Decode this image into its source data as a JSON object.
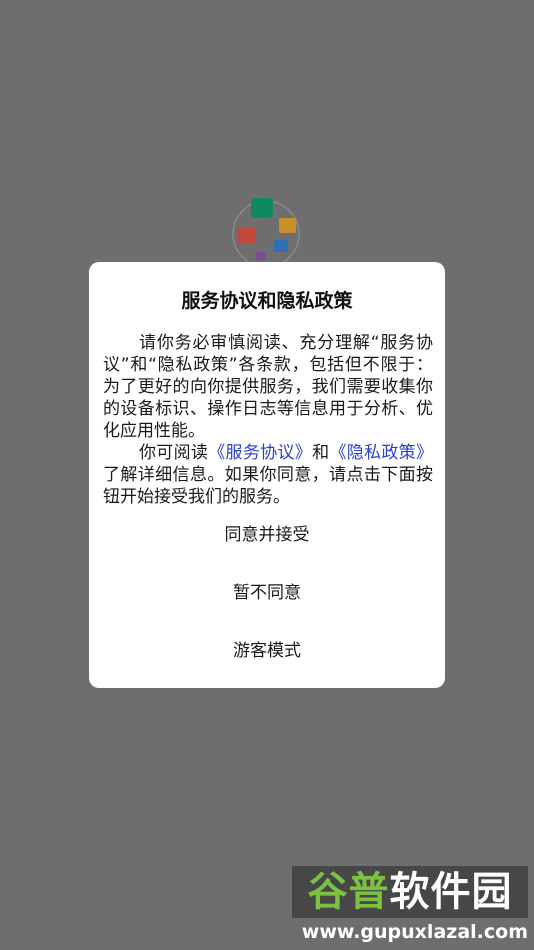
{
  "dialog": {
    "title": "服务协议和隐私政策",
    "paragraph1": "请你务必审慎阅读、充分理解“服务协议”和“隐私政策”各条款，包括但不限于：为了更好的向你提供服务，我们需要收集你的设备标识、操作日志等信息用于分析、优化应用性能。",
    "paragraph2_before": "你可阅读",
    "paragraph2_link1": "《服务协议》",
    "paragraph2_mid": "和",
    "paragraph2_link2": "《隐私政策》",
    "paragraph2_after": "了解详细信息。如果你同意，请点击下面按钮开始接受我们的服务。",
    "actions": {
      "accept": "同意并接受",
      "decline": "暂不同意",
      "guest": "游客模式"
    }
  },
  "watermark": {
    "brand_green": "谷普",
    "brand_white": "软件园",
    "url": "www.gupuxlazal.com"
  },
  "colors": {
    "overlay": "#6e6e6e",
    "link": "#2b3fd6",
    "watermark_green": "#7bc142"
  },
  "icons": {
    "app_logo": "app-logo-icon"
  }
}
